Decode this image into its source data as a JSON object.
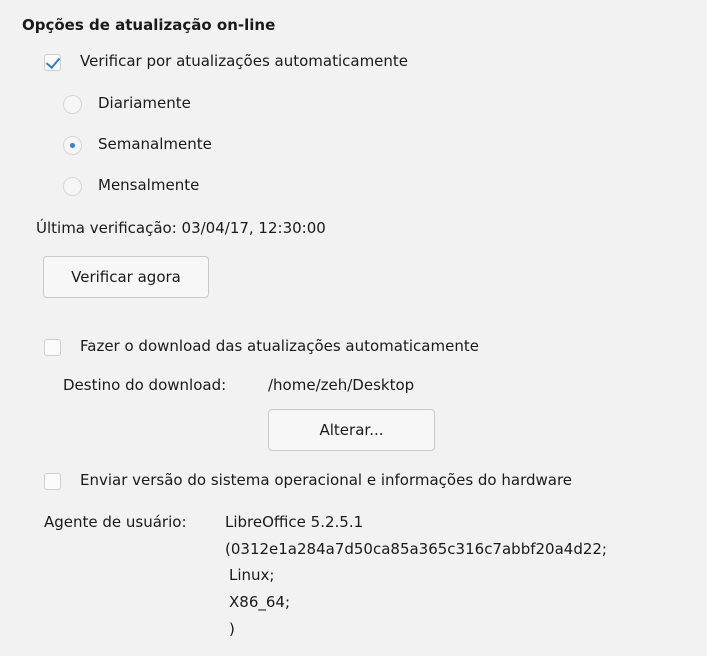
{
  "section_title": "Opções de atualização on-line",
  "auto_check": {
    "label": "Verificar por atualizações automaticamente",
    "checked": true
  },
  "frequency": {
    "options": [
      {
        "label": "Diariamente",
        "selected": false
      },
      {
        "label": "Semanalmente",
        "selected": true
      },
      {
        "label": "Mensalmente",
        "selected": false
      }
    ]
  },
  "last_check": "Última verificação: 03/04/17, 12:30:00",
  "check_now_button": "Verificar agora",
  "auto_download": {
    "label": "Fazer o download das atualizações automaticamente",
    "checked": false
  },
  "download_destination": {
    "label": "Destino do download:",
    "path": "/home/zeh/Desktop"
  },
  "change_button": "Alterar...",
  "send_os_info": {
    "label": "Enviar versão do sistema operacional e informações do hardware",
    "checked": false
  },
  "user_agent": {
    "label": "Agente de usuário:",
    "lines": [
      "LibreOffice 5.2.5.1",
      "(0312e1a284a7d50ca85a365c316c7abbf20a4d22;",
      "Linux;",
      "X86_64;",
      ")"
    ]
  },
  "accent_color": "#2e80d2"
}
